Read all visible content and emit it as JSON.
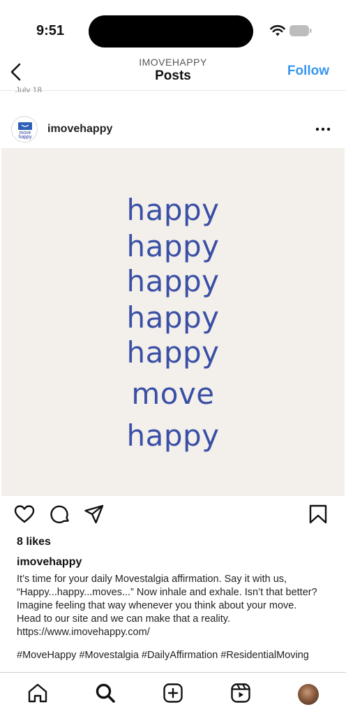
{
  "status": {
    "time": "9:51"
  },
  "nav": {
    "account": "IMOVEHAPPY",
    "title": "Posts",
    "follow": "Follow"
  },
  "prev_post_date": "July 18",
  "post": {
    "username": "imovehappy",
    "avatar_text": "move happy",
    "image_words": [
      "happy",
      "happy",
      "happy",
      "happy",
      "happy",
      "move",
      "happy"
    ],
    "likes": "8 likes",
    "caption_username": "imovehappy",
    "caption_lines": [
      "It’s time for your daily Movestalgia affirmation. Say it with us,",
      "“Happy...happy...moves...” Now inhale and exhale. Isn’t that better?",
      "Imagine feeling that way whenever you think about your move.",
      "Head to our site and we can make that a reality.",
      "https://www.imovehappy.com/"
    ],
    "hashtags": "#MoveHappy #Movestalgia #DailyAffirmation #ResidentialMoving"
  },
  "colors": {
    "link": "#3897f0",
    "brand_text": "#3a4fa5",
    "image_bg": "#f3f0eb"
  },
  "icons": [
    "back-icon",
    "more-icon",
    "heart-icon",
    "comment-icon",
    "share-icon",
    "bookmark-icon",
    "home-icon",
    "search-icon",
    "create-icon",
    "reels-icon"
  ]
}
